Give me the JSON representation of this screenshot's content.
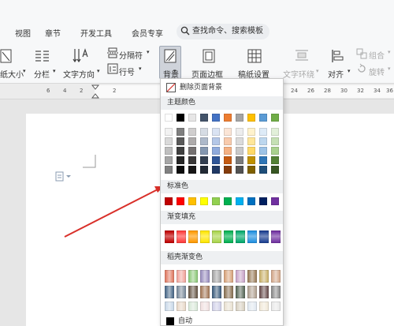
{
  "menubar": {
    "items": [
      "视图",
      "章节",
      "开发工具",
      "会员专享"
    ],
    "search_placeholder": "查找命令、搜索模板"
  },
  "toolbar": {
    "page_size_label": "纸大小",
    "columns_label": "分栏",
    "text_direction_label": "文字方向",
    "separator_label": "分隔符",
    "line_number_label": "行号",
    "background_label": "背景",
    "page_border_label": "页面边框",
    "paper_setting_label": "稿纸设置",
    "text_wrap_label": "文字环绕",
    "align_label": "对齐",
    "group_label": "组合",
    "rotate_label": "旋转"
  },
  "ruler": {
    "numbers": [
      "6",
      "4",
      "2",
      "2",
      "24",
      "26",
      "28",
      "30",
      "32",
      "34",
      "36",
      "38",
      "40"
    ]
  },
  "dropdown": {
    "remove_background": "删除页面背景",
    "theme_colors_title": "主题颜色",
    "standard_colors_title": "标准色",
    "gradient_fill_title": "渐变填充",
    "docer_gradient_title": "稻壳渐变色",
    "auto_label": "自动",
    "theme_top": [
      "#ffffff",
      "#000000",
      "#e7e6e6",
      "#44546a",
      "#4472c4",
      "#ed7d31",
      "#a5a5a5",
      "#ffc000",
      "#5b9bd5",
      "#70ad47"
    ],
    "theme_shades": [
      [
        "#f2f2f2",
        "#7f7f7f",
        "#d0cece",
        "#d6dce4",
        "#dae3f3",
        "#fbe5d6",
        "#ededed",
        "#fff2cc",
        "#deebf7",
        "#e2f0d9"
      ],
      [
        "#d9d9d9",
        "#595959",
        "#aeabab",
        "#adb9ca",
        "#b4c7e7",
        "#f8cbad",
        "#dbdbdb",
        "#ffe699",
        "#bdd7ee",
        "#c5e0b4"
      ],
      [
        "#bfbfbf",
        "#404040",
        "#757171",
        "#8497b0",
        "#8faadc",
        "#f4b183",
        "#c9c9c9",
        "#ffd966",
        "#9dc3e6",
        "#a9d18e"
      ],
      [
        "#a6a6a6",
        "#262626",
        "#3a3838",
        "#333f50",
        "#2f5597",
        "#c55a11",
        "#7b7b7b",
        "#bf9000",
        "#2e75b6",
        "#538135"
      ],
      [
        "#808080",
        "#0d0d0d",
        "#171616",
        "#222a35",
        "#203864",
        "#843c0c",
        "#525252",
        "#7f6000",
        "#1f4e79",
        "#375623"
      ]
    ],
    "standard": [
      "#c00000",
      "#ff0000",
      "#ffc000",
      "#ffff00",
      "#92d050",
      "#00b050",
      "#00b0f0",
      "#0070c0",
      "#002060",
      "#7030a0"
    ],
    "gradient": [
      "#c00000",
      "#ff3b3b",
      "#ff9900",
      "#ffe600",
      "#a8d44a",
      "#00b050",
      "#00a86b",
      "#1f8fe0",
      "#1a3f91",
      "#7030a0"
    ],
    "docer_rows": [
      [
        "#e07a63",
        "#f0a39b",
        "#8ec97a",
        "#9a8fbf",
        "#a3a3a3",
        "#d8a37b",
        "#c8a4c8",
        "#9a7d5b",
        "#c9b26c",
        "#d3a88b"
      ],
      [
        "#4b6a8a",
        "#7a8b9c",
        "#6a5a4a",
        "#a67b5b",
        "#3f5f7f",
        "#8b7355",
        "#5a6a5a",
        "#b0a090",
        "#6b4f4f",
        "#8c8c8c"
      ],
      [
        "#c8d8e8",
        "#e8d8c8",
        "#d8e8d8",
        "#f0e0e0",
        "#d0d0e8",
        "#e8e0d0",
        "#d8d0c0",
        "#e0e8f0",
        "#f0e8d8",
        "#e8e8e8"
      ]
    ],
    "auto_color": "#000000"
  },
  "colors": {
    "annotation_arrow": "#d9302a"
  }
}
